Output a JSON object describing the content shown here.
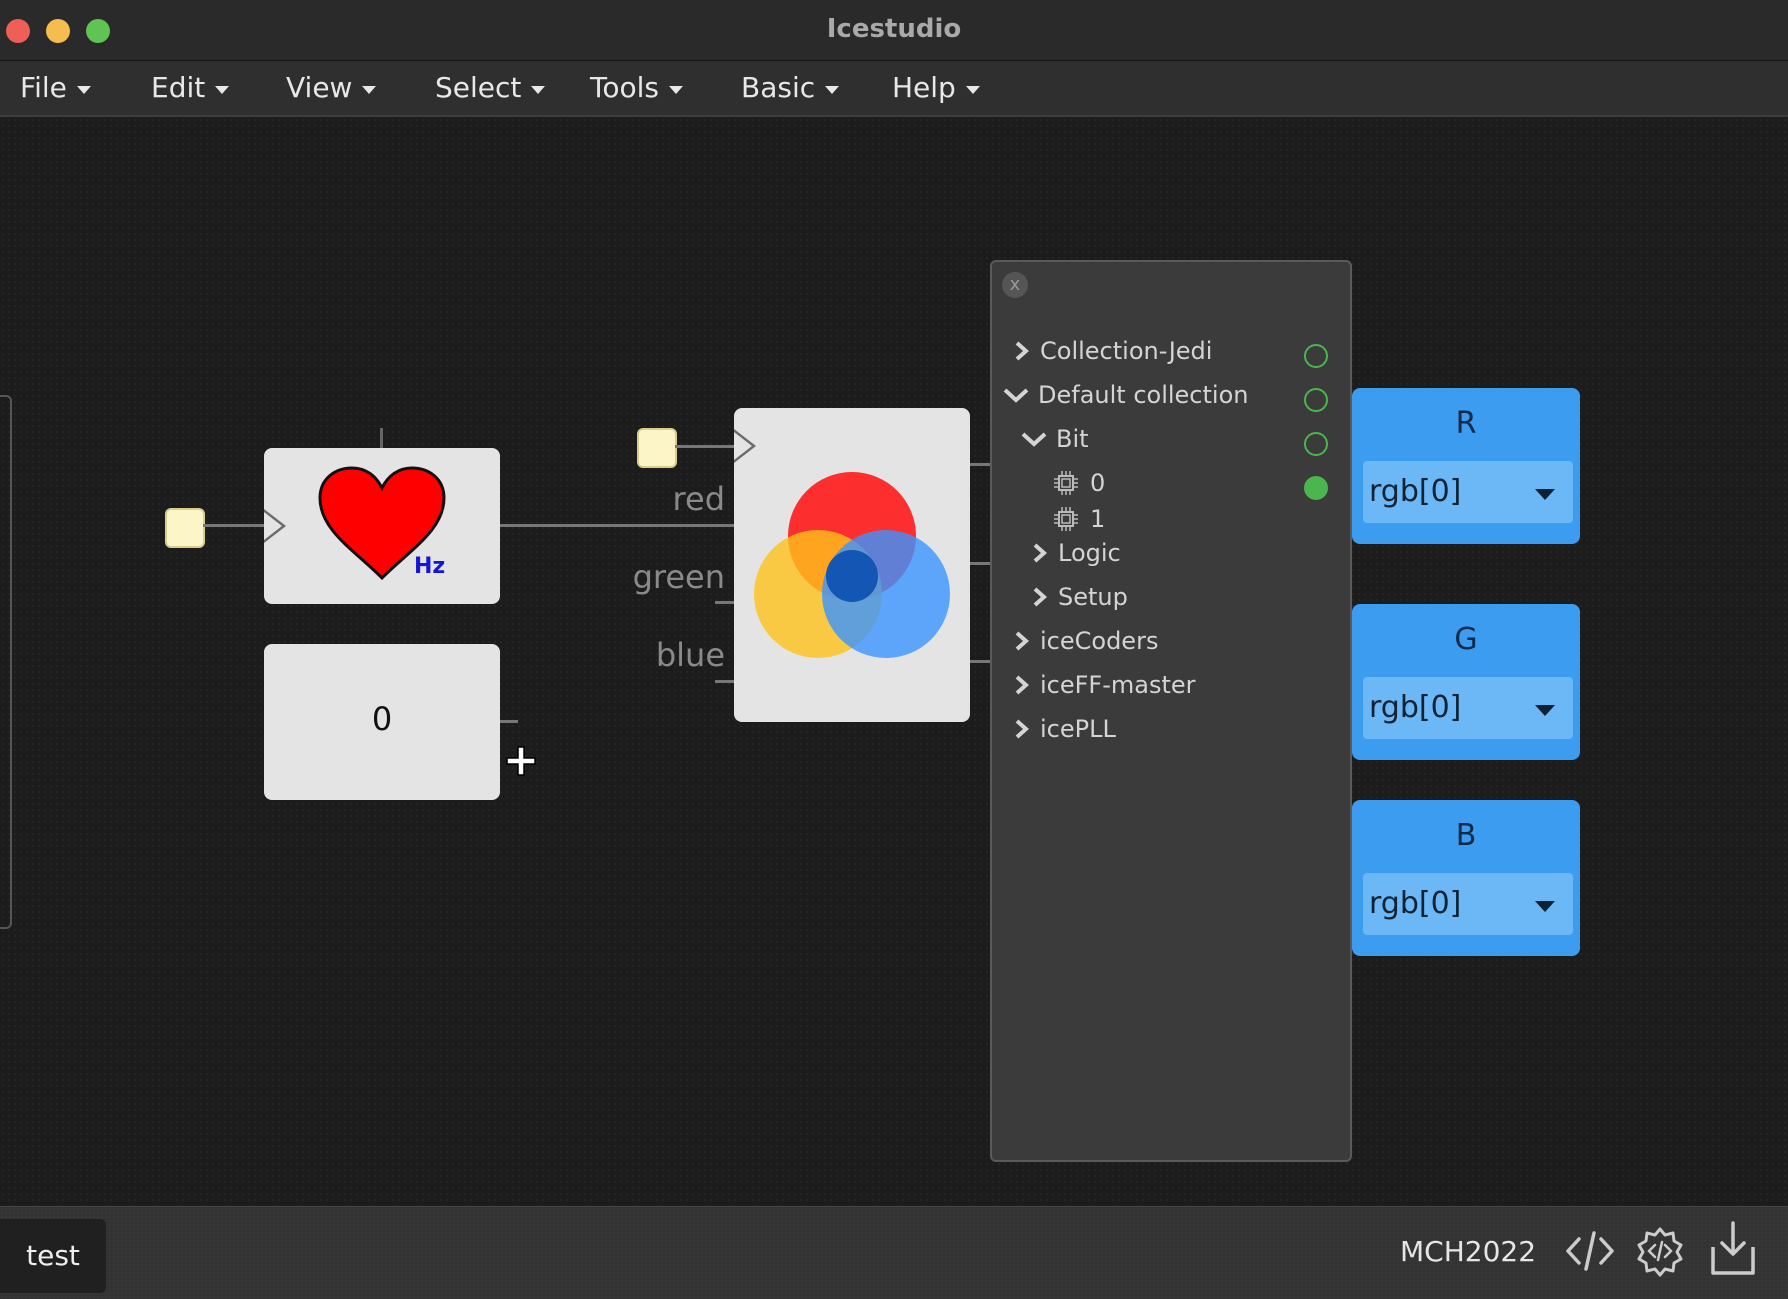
{
  "window": {
    "title": "Icestudio"
  },
  "menu": [
    {
      "label": "File"
    },
    {
      "label": "Edit"
    },
    {
      "label": "View"
    },
    {
      "label": "Select"
    },
    {
      "label": "Tools"
    },
    {
      "label": "Basic"
    },
    {
      "label": "Help"
    }
  ],
  "canvas": {
    "heart_block": {
      "unit": "Hz"
    },
    "constant_block": {
      "value": "0"
    },
    "rgb_block": {
      "ports": {
        "red": "red",
        "green": "green",
        "blue": "blue"
      }
    }
  },
  "collections_panel": {
    "close": "x",
    "items": [
      {
        "label": "Collection-Jedi",
        "expanded": false
      },
      {
        "label": "Default collection",
        "expanded": true
      },
      {
        "label": "Bit",
        "expanded": true
      },
      {
        "label": "0"
      },
      {
        "label": "1"
      },
      {
        "label": "Logic",
        "expanded": false
      },
      {
        "label": "Setup",
        "expanded": false
      },
      {
        "label": "iceCoders",
        "expanded": false
      },
      {
        "label": "iceFF-master",
        "expanded": false
      },
      {
        "label": "icePLL",
        "expanded": false
      }
    ]
  },
  "outputs": [
    {
      "name": "R",
      "pin": "rgb[0]"
    },
    {
      "name": "G",
      "pin": "rgb[0]"
    },
    {
      "name": "B",
      "pin": "rgb[0]"
    }
  ],
  "statusbar": {
    "project": "test",
    "board": "MCH2022"
  },
  "colors": {
    "accent": "#3b9cf0",
    "active_dot": "#4bb54e"
  }
}
